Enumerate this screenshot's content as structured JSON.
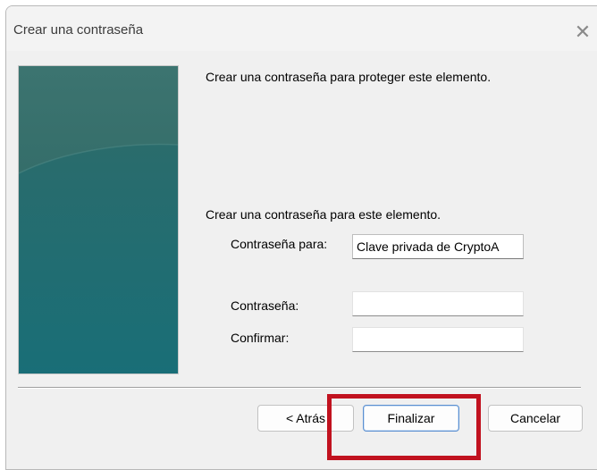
{
  "window": {
    "title": "Crear una contraseña",
    "close_icon": "close-icon"
  },
  "content": {
    "intro": "Crear una contraseña para proteger este elemento.",
    "section": "Crear una contraseña para este elemento.",
    "password_for": {
      "label": "Contraseña para:",
      "value": "Clave privada de CryptoA"
    },
    "password": {
      "label": "Contraseña:",
      "value": ""
    },
    "confirm": {
      "label": "Confirmar:",
      "value": ""
    }
  },
  "buttons": {
    "back": "< Atrás",
    "finish": "Finalizar",
    "cancel": "Cancelar"
  },
  "colors": {
    "banner": "#1f6c70",
    "highlight": "#c1121f",
    "window": "#f0f0f0"
  }
}
